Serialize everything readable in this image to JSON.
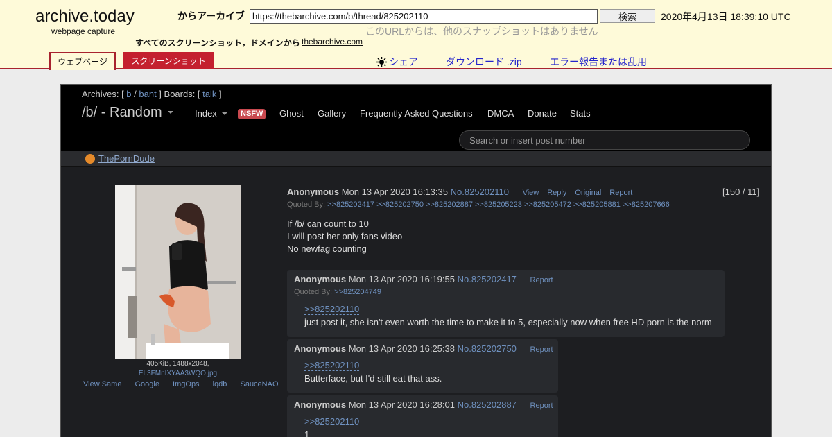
{
  "archive": {
    "logo": "archive.today",
    "logo_sub": "webpage capture",
    "from_label": "からアーカイブ",
    "url_value": "https://thebarchive.com/b/thread/825202110",
    "search_button": "検索",
    "capture_date": "2020年4月13日 18:39:10 UTC",
    "no_snapshots": "このURLからは、他のスナップショットはありません",
    "all_screenshots_label": "すべてのスクリーンショット，ドメインから",
    "domain_link": "thebarchive.com",
    "tabs": {
      "webpage": "ウェブページ",
      "screenshot": "スクリーンショット"
    },
    "actions": {
      "share": "シェア",
      "download": "ダウンロード .zip",
      "report": "エラー報告または乱用"
    },
    "accent_color": "#a8232f"
  },
  "site": {
    "archives_prefix": "Archives: [ ",
    "archives": [
      "b",
      "bant"
    ],
    "boards_prefix": " ] Boards: [ ",
    "boards": [
      "talk"
    ],
    "boards_suffix": " ]",
    "board_title": "/b/ - Random",
    "nav": {
      "index": "Index",
      "nsfw": "NSFW",
      "ghost": "Ghost",
      "gallery": "Gallery",
      "faq": "Frequently Asked Questions",
      "dmca": "DMCA",
      "donate": "Donate",
      "stats": "Stats"
    },
    "search_placeholder": "Search or insert post number",
    "ad_link": "ThePornDude"
  },
  "op": {
    "file_meta": "405KiB, 1488x2048,",
    "file_name": "EL3FMnIXYAA3WQO.jpg",
    "image_tools": [
      "View Same",
      "Google",
      "ImgOps",
      "iqdb",
      "SauceNAO"
    ],
    "name": "Anonymous",
    "date": "Mon 13 Apr 2020 16:13:35",
    "number": "No.825202110",
    "links": [
      "View",
      "Reply",
      "Original",
      "Report"
    ],
    "count": "[150 / 11]",
    "quoted_by_label": "Quoted By:",
    "quoted_by": ">>825202417 >>825202750 >>825202887 >>825205223 >>825205472 >>825205881 >>825207666",
    "body": [
      "If /b/ can count to 10",
      "I will post her only fans video",
      "No newfag counting"
    ]
  },
  "replies": [
    {
      "name": "Anonymous",
      "date": "Mon 13 Apr 2020 16:19:55",
      "number": "No.825202417",
      "report": "Report",
      "quoted_by_label": "Quoted By:",
      "quoted_by": ">>825204749",
      "quote_link": ">>825202110",
      "body": "just post it, she isn't even worth the time to make it to 5, especially now when free HD porn is the norm"
    },
    {
      "name": "Anonymous",
      "date": "Mon 13 Apr 2020 16:25:38",
      "number": "No.825202750",
      "report": "Report",
      "quote_link": ">>825202110",
      "body": "Butterface, but I'd still eat that ass."
    },
    {
      "name": "Anonymous",
      "date": "Mon 13 Apr 2020 16:28:01",
      "number": "No.825202887",
      "report": "Report",
      "quote_link": ">>825202110",
      "body": "1"
    }
  ]
}
